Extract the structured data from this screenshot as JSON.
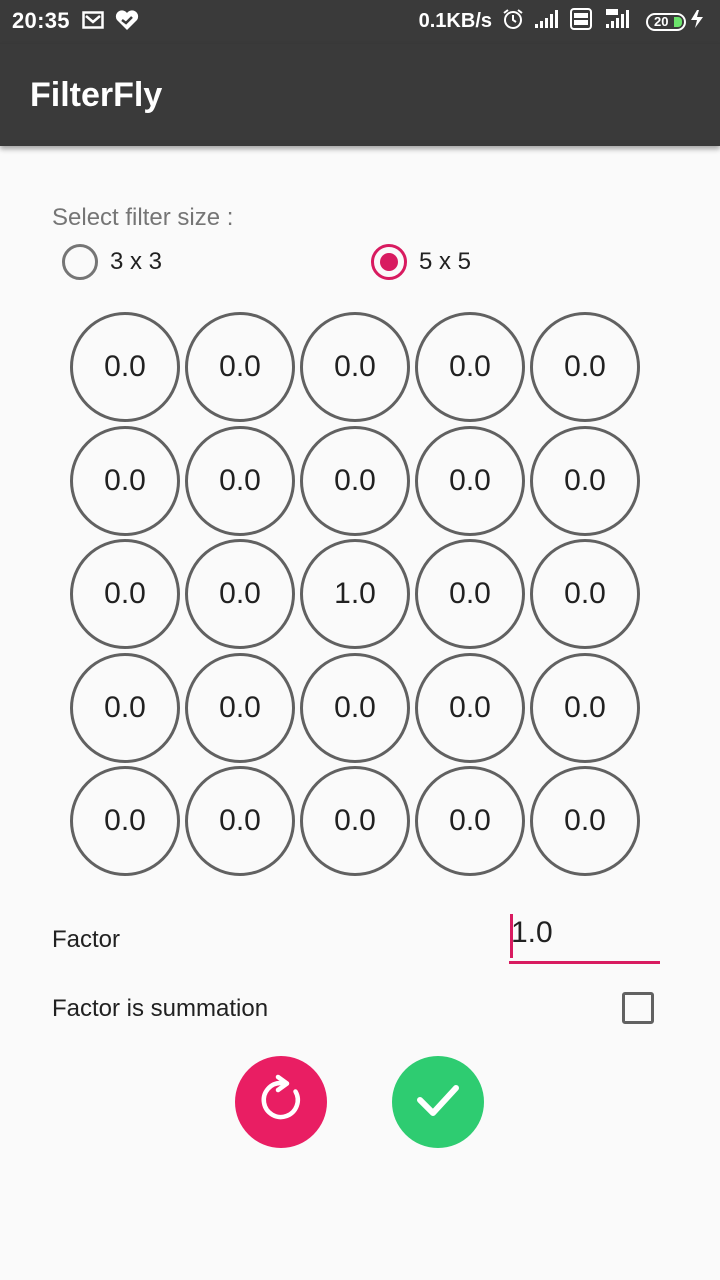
{
  "status_bar": {
    "time": "20:35",
    "left_icons": [
      "gmail-icon",
      "heart-check-icon"
    ],
    "network_speed": "0.1KB/s",
    "right_icons": [
      "alarm-icon",
      "signal-icon",
      "volte-icon",
      "4g-signal-icon"
    ],
    "battery_level": "20"
  },
  "app_bar": {
    "title": "FilterFly"
  },
  "filter_size": {
    "label": "Select filter size :",
    "options": [
      {
        "label": "3 x 3",
        "selected": false
      },
      {
        "label": "5 x 5",
        "selected": true
      }
    ]
  },
  "matrix": {
    "rows": [
      [
        "0.0",
        "0.0",
        "0.0",
        "0.0",
        "0.0"
      ],
      [
        "0.0",
        "0.0",
        "0.0",
        "0.0",
        "0.0"
      ],
      [
        "0.0",
        "0.0",
        "1.0",
        "0.0",
        "0.0"
      ],
      [
        "0.0",
        "0.0",
        "0.0",
        "0.0",
        "0.0"
      ],
      [
        "0.0",
        "0.0",
        "0.0",
        "0.0",
        "0.0"
      ]
    ]
  },
  "factor": {
    "label": "Factor",
    "value": "1.0"
  },
  "summation": {
    "label": "Factor is summation",
    "checked": false
  },
  "actions": {
    "reset_icon": "refresh-icon",
    "apply_icon": "check-icon"
  },
  "colors": {
    "accent": "#d81b60",
    "appbar": "#3a3a3a",
    "reset_button": "#e91e63",
    "apply_button": "#2ecc71"
  }
}
